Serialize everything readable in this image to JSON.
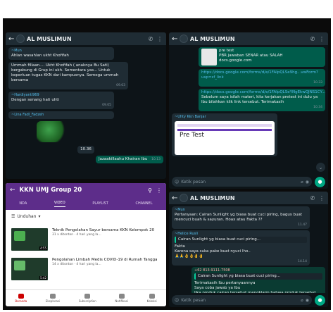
{
  "chat1": {
    "title": "AL MUSLIMUN",
    "messages": [
      {
        "type": "in",
        "sender": "~Mun",
        "text": "Ahlan wasahlan ukht Khofifah",
        "time": ""
      },
      {
        "type": "in",
        "sender": "",
        "text": "Ummah fillaan.... Ukht Khofifah ( anaknya Bu Sati) bergabung di Grup ini ukh. Sementara yas... Untuk keperluan tugas KKN dari kampusnya. Semoga ummah bersama",
        "time": "09.03"
      },
      {
        "type": "in",
        "sender": "~Hardiyanti969",
        "text": "Dengan senang hati uhti",
        "time": "09.05"
      },
      {
        "type": "in",
        "sender": "",
        "text": "~Lina Fadl_Fadzeh",
        "time": ""
      },
      {
        "type": "out",
        "sender": "",
        "text": "Jazaakillaahu Khairan Ibu",
        "time": "10.13"
      }
    ],
    "sticker_label": "",
    "date_chip": "10.36"
  },
  "chat2": {
    "title": "AL MUSLIMUN",
    "messages": [
      {
        "type": "out",
        "sender": "",
        "text": "pre test\nPBR jawaban SENAR atau SALAH\ndocs.google.com",
        "time": ""
      },
      {
        "type": "out",
        "sender": "",
        "text": "https://docs.google.com/forms/d/e/1FAIpQLSe9hg...vwForm?usp=sf_link",
        "time": "10.33"
      },
      {
        "type": "in",
        "sender": "",
        "text": "https://docs.google.com/forms/d/e/1FAIpQLSeYNgEkwQJNS1CY...",
        "time": ""
      },
      {
        "type": "in",
        "sender": "",
        "text": "Sebelum saya isilah materi, kita kerjakan pretest ini dulu ya Ibu bilahkan klik link tersebut. Terimakasih",
        "time": "10.34"
      },
      {
        "type": "in",
        "sender": "~Uhty Kkn Banjar",
        "text": "",
        "time": ""
      }
    ],
    "preview_title": "Pre Test",
    "input_placeholder": "Ketik pesan"
  },
  "youtube": {
    "title": "KKN UMJ Group 20",
    "tabs": [
      "NDA",
      "VIDEO",
      "PLAYLIST",
      "CHANNEL"
    ],
    "sort_label": "Unduhan",
    "videos": [
      {
        "title": "Teknik Pengolahan Sayur bersama KKN Kelompok 20",
        "meta": "31 x ditonton · 4 hari yang la...",
        "duration": "4:55"
      },
      {
        "title": "Pengolahan Limbah Medis COVID-19 di Rumah Tangga",
        "meta": "14 x ditonton · 4 hari yang la...",
        "duration": "5:42"
      }
    ],
    "nav": [
      "Beranda",
      "Eksplorasi",
      "Subscription",
      "Notifikasi",
      "Koleksi"
    ]
  },
  "chat3": {
    "title": "AL MUSLIMUN",
    "messages": [
      {
        "type": "in",
        "sender": "~Mun",
        "text": "Pertanyaan: Cairan Sunlight yg biasa buat cuci piring, bagus buat mencuci buah & sayuran. Hoax atau Fakta ??",
        "time": "11.47"
      },
      {
        "type": "in",
        "sender": "~Helice Rusli",
        "quote": "Cairan Sunlight yg biasa buat cuci piring...",
        "text": "Fakta",
        "time": "14.12"
      },
      {
        "type": "in",
        "sender": "",
        "text": "Karena saya suka pake buat nyuci lho..",
        "time": "14.14"
      },
      {
        "type": "in",
        "sender": "+62 813-9111-7508",
        "quote": "Cairan Sunlight yg biasa buat cuci piring...",
        "text": "Terimakasih Ibu pertanyaannya\nSaya coba jawab ya Ibu\nJika produk cairan tersebut mengklaim bahwa produk tersebut bisa digunakan",
        "time": ""
      }
    ],
    "input_placeholder": "Ketik pesan"
  },
  "colors": {
    "wa_bg": "#0d1418",
    "wa_bar": "#1f2c34",
    "out_bubble": "#005c4b",
    "yt_header": "#5d2d8a"
  }
}
